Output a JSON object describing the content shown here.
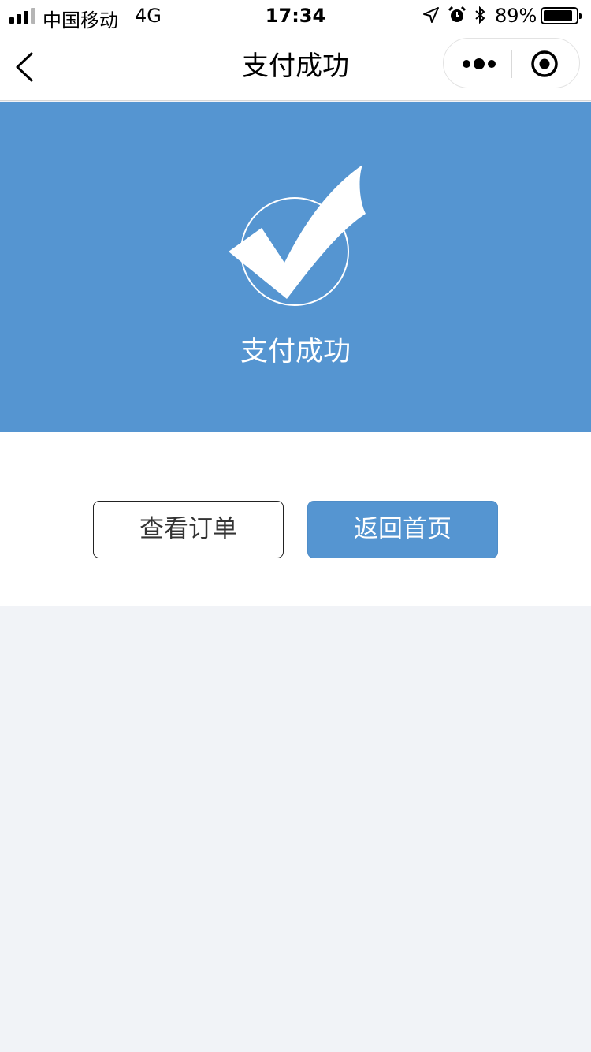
{
  "status_bar": {
    "carrier": "中国移动",
    "network": "4G",
    "time": "17:34",
    "battery_percent": "89%",
    "battery_level": 0.89,
    "icons": [
      "signal-icon",
      "location-icon",
      "alarm-icon",
      "bluetooth-icon",
      "battery-icon"
    ]
  },
  "nav": {
    "title": "支付成功",
    "back_icon": "chevron-left-icon",
    "more_icon": "more-dots-icon",
    "close_icon": "target-close-icon"
  },
  "banner": {
    "message": "支付成功",
    "icon": "checkmark-circle-icon",
    "color": "#5595d1"
  },
  "actions": {
    "view_orders_label": "查看订单",
    "home_label": "返回首页"
  },
  "colors": {
    "accent": "#5595d1",
    "page_background": "#f1f3f7"
  }
}
